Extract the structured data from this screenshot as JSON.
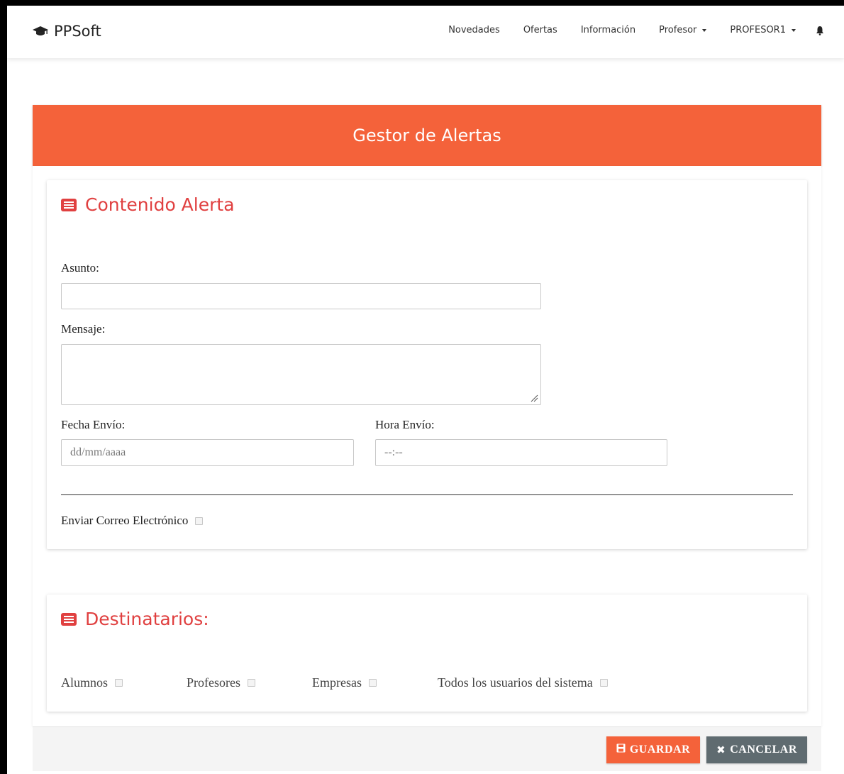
{
  "navbar": {
    "brand": "PPSoft",
    "links": [
      "Novedades",
      "Ofertas",
      "Información"
    ],
    "profesor_menu": "Profesor",
    "user_menu": "PROFESOR1"
  },
  "header": {
    "title": "Gestor de Alertas"
  },
  "contenido": {
    "title": "Contenido Alerta",
    "asunto_label": "Asunto:",
    "asunto_value": "",
    "mensaje_label": "Mensaje:",
    "mensaje_value": "",
    "fecha_label": "Fecha Envío:",
    "fecha_placeholder": "dd/mm/aaaa",
    "hora_label": "Hora Envío:",
    "hora_placeholder": "--:--",
    "email_label": "Enviar Correo Electrónico",
    "email_checked": false
  },
  "destinatarios": {
    "title": "Destinatarios:",
    "options": [
      {
        "label": "Alumnos",
        "checked": false
      },
      {
        "label": "Profesores",
        "checked": false
      },
      {
        "label": "Empresas",
        "checked": false
      },
      {
        "label": "Todos los usuarios del sistema",
        "checked": false
      }
    ]
  },
  "footer": {
    "guardar": "GUARDAR",
    "cancelar": "CANCELAR"
  },
  "colors": {
    "accent": "#f4623a",
    "title_red": "#e04040",
    "cancel_gray": "#5f6b70"
  }
}
